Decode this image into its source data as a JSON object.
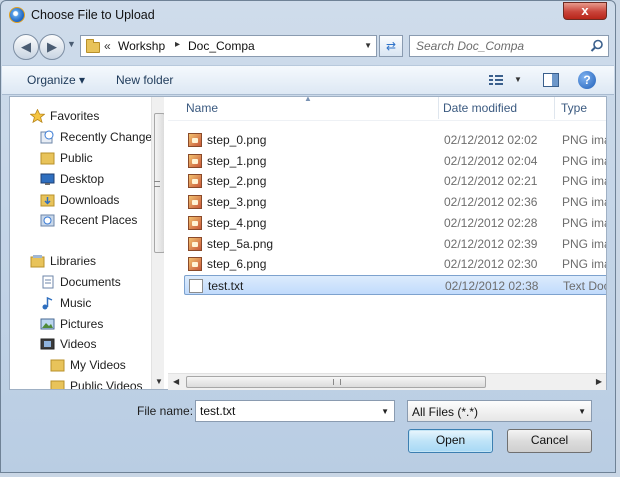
{
  "window": {
    "title": "Choose File to Upload",
    "close_label": "x"
  },
  "address": {
    "overflow": "«",
    "crumbs": [
      "Workshp",
      "Doc_Compa"
    ],
    "separator": "▸"
  },
  "search": {
    "placeholder": "Search Doc_Compa"
  },
  "toolbar": {
    "organize_label": "Organize ▾",
    "new_folder_label": "New folder",
    "help_label": "?"
  },
  "nav": {
    "items": [
      {
        "label": "Favorites",
        "icon": "star-icon"
      },
      {
        "label": "Recently Changed",
        "icon": "recent-changed-icon"
      },
      {
        "label": "Public",
        "icon": "folder-icon"
      },
      {
        "label": "Desktop",
        "icon": "desktop-icon"
      },
      {
        "label": "Downloads",
        "icon": "downloads-icon"
      },
      {
        "label": "Recent Places",
        "icon": "recent-places-icon"
      },
      {
        "label": "Libraries",
        "icon": "libraries-icon"
      },
      {
        "label": "Documents",
        "icon": "documents-icon"
      },
      {
        "label": "Music",
        "icon": "music-icon"
      },
      {
        "label": "Pictures",
        "icon": "pictures-icon"
      },
      {
        "label": "Videos",
        "icon": "videos-icon"
      },
      {
        "label": "My Videos",
        "icon": "folder-icon"
      },
      {
        "label": "Public Videos",
        "icon": "folder-icon"
      }
    ]
  },
  "files": {
    "columns": {
      "name": "Name",
      "date": "Date modified",
      "type": "Type"
    },
    "rows": [
      {
        "name": "step_0.png",
        "date": "02/12/2012 02:02",
        "type": "PNG imag"
      },
      {
        "name": "step_1.png",
        "date": "02/12/2012 02:04",
        "type": "PNG imag"
      },
      {
        "name": "step_2.png",
        "date": "02/12/2012 02:21",
        "type": "PNG imag"
      },
      {
        "name": "step_3.png",
        "date": "02/12/2012 02:36",
        "type": "PNG imag"
      },
      {
        "name": "step_4.png",
        "date": "02/12/2012 02:28",
        "type": "PNG imag"
      },
      {
        "name": "step_5a.png",
        "date": "02/12/2012 02:39",
        "type": "PNG imag"
      },
      {
        "name": "step_6.png",
        "date": "02/12/2012 02:30",
        "type": "PNG imag"
      },
      {
        "name": "test.txt",
        "date": "02/12/2012 02:38",
        "type": "Text Docu",
        "selected": true
      }
    ]
  },
  "footer": {
    "file_name_label": "File name:",
    "file_name_value": "test.txt",
    "filter_label": "All Files (*.*)",
    "open_label": "Open",
    "cancel_label": "Cancel"
  }
}
